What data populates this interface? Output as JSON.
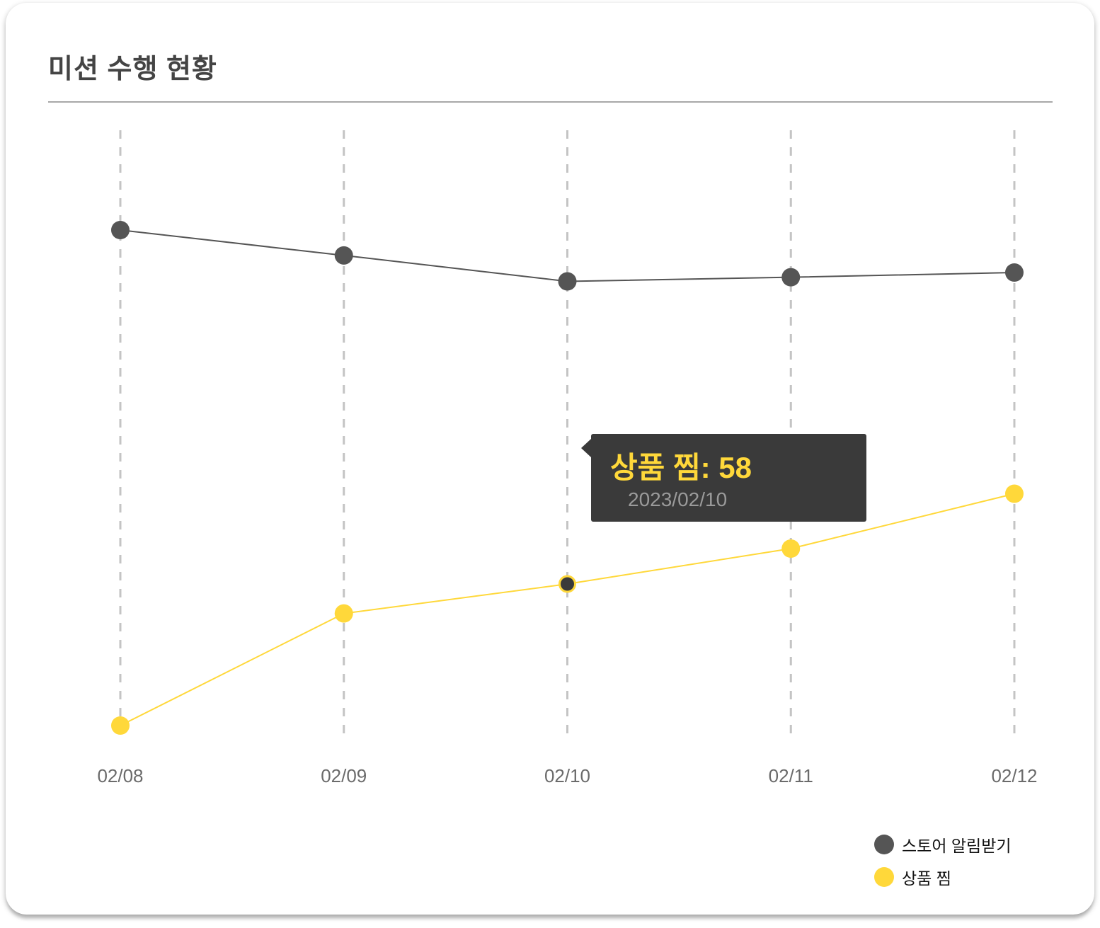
{
  "card": {
    "title": "미션 수행 현황"
  },
  "tooltip": {
    "label": "상품 찜: 58",
    "date": "2023/02/10"
  },
  "chart_data": {
    "type": "line",
    "title": "",
    "categories": [
      "02/08",
      "02/09",
      "02/10",
      "02/11",
      "02/12"
    ],
    "ylim": [
      34,
      124
    ],
    "grid": "vertical-dashed",
    "legend_position": "bottom-right",
    "series": [
      {
        "name": "스토어 알림받기",
        "color": "#555555",
        "values": [
          118,
          113.7,
          109.3,
          110,
          110.8
        ]
      },
      {
        "name": "상품 찜",
        "color": "#ffd83a",
        "values": [
          34,
          53,
          58,
          64,
          73.3
        ]
      }
    ],
    "highlight": {
      "series": 1,
      "index": 2
    }
  }
}
